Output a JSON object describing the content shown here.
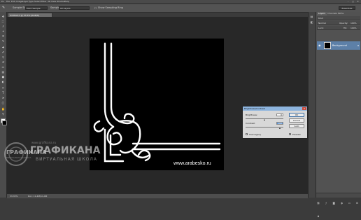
{
  "menubar": {
    "items": [
      "Ps",
      "File",
      "Edit",
      "Image",
      "Layer",
      "Type",
      "Select",
      "Filter",
      "3D",
      "View",
      "Window",
      "Help"
    ],
    "window_buttons": [
      "–",
      "▢",
      "✕"
    ]
  },
  "options": {
    "sample_size_label": "Sample Size:",
    "sample_size_value": "Point Sample",
    "sample_label": "Sample:",
    "sample_value": "All Layers",
    "show_ring_label": "Show Sampling Ring",
    "workspace": "Essentials"
  },
  "document": {
    "tab_title": "Untitled-1 @ 33.3% (RGB/8)",
    "canvas_text": "www.arabesko.ru",
    "zoom": "33.33%",
    "doc_size": "Doc: 11,4M/11,4M"
  },
  "layers_panel": {
    "tabs": [
      "Layers",
      "Channels",
      "Paths"
    ],
    "filter_kind": "Kind",
    "blend_mode": "Normal",
    "opacity_label": "Opacity:",
    "opacity_value": "100%",
    "lock_label": "Lock:",
    "fill_label": "Fill:",
    "fill_value": "100%",
    "layer_name": "Background"
  },
  "dialog": {
    "title": "Brightness/Contrast",
    "brightness_label": "Brightness:",
    "brightness_value": "0",
    "contrast_label": "Contrast:",
    "contrast_value": "100",
    "use_legacy_label": "Use Legacy",
    "use_legacy_checked": true,
    "ok_label": "OK",
    "cancel_label": "Cancel",
    "auto_label": "Auto",
    "preview_label": "Preview",
    "preview_checked": true
  },
  "watermark": {
    "site": "www.grafikana.ru",
    "title": "ГРАФИКАНА",
    "subtitle": "ВИРТУАЛЬНАЯ ШКОЛА",
    "left_title": "ГРАФИКАНА",
    "left_sub": "ВИРТУАЛЬНАЯ ШКОЛА"
  },
  "icons": [
    "move-icon",
    "marquee-icon",
    "lasso-icon",
    "quick-select-icon",
    "crop-icon",
    "eyedropper-icon",
    "healing-icon",
    "brush-icon",
    "stamp-icon",
    "history-brush-icon",
    "eraser-icon",
    "gradient-icon",
    "blur-icon",
    "dodge-icon",
    "pen-icon",
    "type-icon",
    "path-select-icon",
    "shape-icon",
    "hand-icon",
    "zoom-icon"
  ],
  "colors": {
    "layer_selected": "#5d80a8",
    "dialog_title": "#8db4de",
    "canvas": "#000000"
  }
}
